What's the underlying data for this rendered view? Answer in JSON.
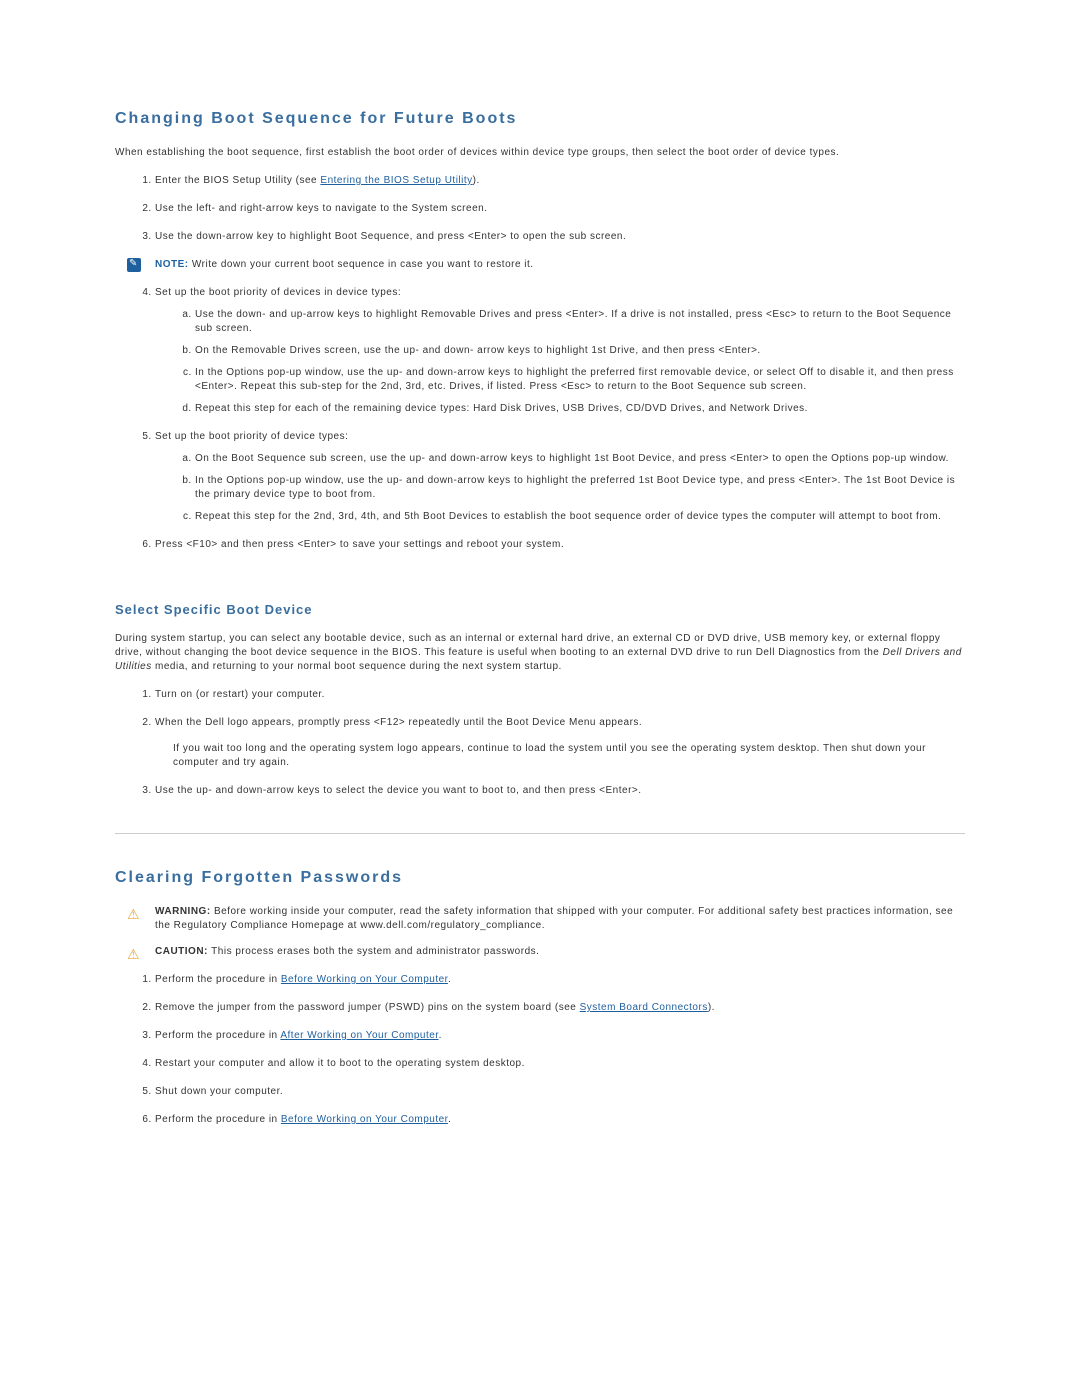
{
  "h2a": "Changing Boot Sequence for Future Boots",
  "p1": "When establishing the boot sequence, first establish the boot order of devices within device type groups, then select the boot order of device types.",
  "s1_prefix": "Enter the BIOS Setup Utility (see ",
  "s1_link": "Entering the BIOS Setup Utility",
  "s1_suffix": ").",
  "s2": "Use the left- and right-arrow keys to navigate to the System screen.",
  "s3": "Use the down-arrow key to highlight Boot Sequence, and press <Enter> to open the sub screen.",
  "note_label": "NOTE: ",
  "note_body": "Write down your current boot sequence in case you want to restore it.",
  "s4": "Set up the boot priority of devices in device types:",
  "s4a": "Use the down- and up-arrow keys to highlight Removable Drives and press <Enter>. If a drive is not installed, press <Esc> to return to the Boot Sequence sub screen.",
  "s4b": "On the Removable Drives screen, use the up- and down- arrow keys to highlight 1st Drive, and then press <Enter>.",
  "s4c": "In the Options pop-up window, use the up- and down-arrow keys to highlight the preferred first removable device, or select Off to disable it, and then press <Enter>. Repeat this sub-step for the 2nd, 3rd, etc. Drives, if listed. Press <Esc> to return to the Boot Sequence sub screen.",
  "s4d": "Repeat this step for each of the remaining device types: Hard Disk Drives, USB Drives, CD/DVD Drives, and Network Drives.",
  "s5": "Set up the boot priority of device types:",
  "s5a": "On the Boot Sequence sub screen, use the up- and down-arrow keys to highlight 1st Boot Device, and press <Enter> to open the Options pop-up window.",
  "s5b": "In the Options pop-up window, use the up- and down-arrow keys to highlight the preferred 1st Boot Device type, and press <Enter>. The 1st Boot Device is the primary device type to boot from.",
  "s5c": "Repeat this step for the 2nd, 3rd, 4th, and 5th Boot Devices to establish the boot sequence order of device types the computer will attempt to boot from.",
  "s6": "Press <F10> and then press <Enter> to save your settings and reboot your system.",
  "h3a": "Select Specific Boot Device",
  "p2a": "During system startup, you can select any bootable device, such as an internal or external hard drive, an external CD or DVD drive, USB memory key, or external floppy drive, without changing the boot device sequence in the BIOS. This feature is useful when booting to an external DVD drive to run Dell Diagnostics from the ",
  "p2b": "Dell Drivers and Utilities",
  "p2c": " media, and returning to your normal boot sequence during the next system startup.",
  "b1": "Turn on (or restart) your computer.",
  "b2": "When the Dell logo appears, promptly press <F12> repeatedly until the Boot Device Menu appears.",
  "b2_extra": "If you wait too long and the operating system logo appears, continue to load the system until you see the operating system desktop. Then shut down your computer and try again.",
  "b3": "Use the up- and down-arrow keys to select the device you want to boot to, and then press <Enter>.",
  "h2b": "Clearing Forgotten Passwords",
  "warn_label": "WARNING: ",
  "warn_body": "Before working inside your computer, read the safety information that shipped with your computer. For additional safety best practices information, see the Regulatory Compliance Homepage at www.dell.com/regulatory_compliance.",
  "caut_label": "CAUTION: ",
  "caut_body": "This process erases both the system and administrator passwords.",
  "c1a": "Perform the procedure in ",
  "c1link": "Before Working on Your Computer",
  "c1b": ".",
  "c2a": "Remove the jumper from the password jumper (PSWD) pins on the system board (see ",
  "c2link": "System Board Connectors",
  "c2b": ").",
  "c3a": "Perform the procedure in ",
  "c3link": "After Working on Your Computer",
  "c3b": ".",
  "c4": "Restart your computer and allow it to boot to the operating system desktop.",
  "c5": "Shut down your computer.",
  "c6a": "Perform the procedure in ",
  "c6link": "Before Working on Your Computer",
  "c6b": "."
}
